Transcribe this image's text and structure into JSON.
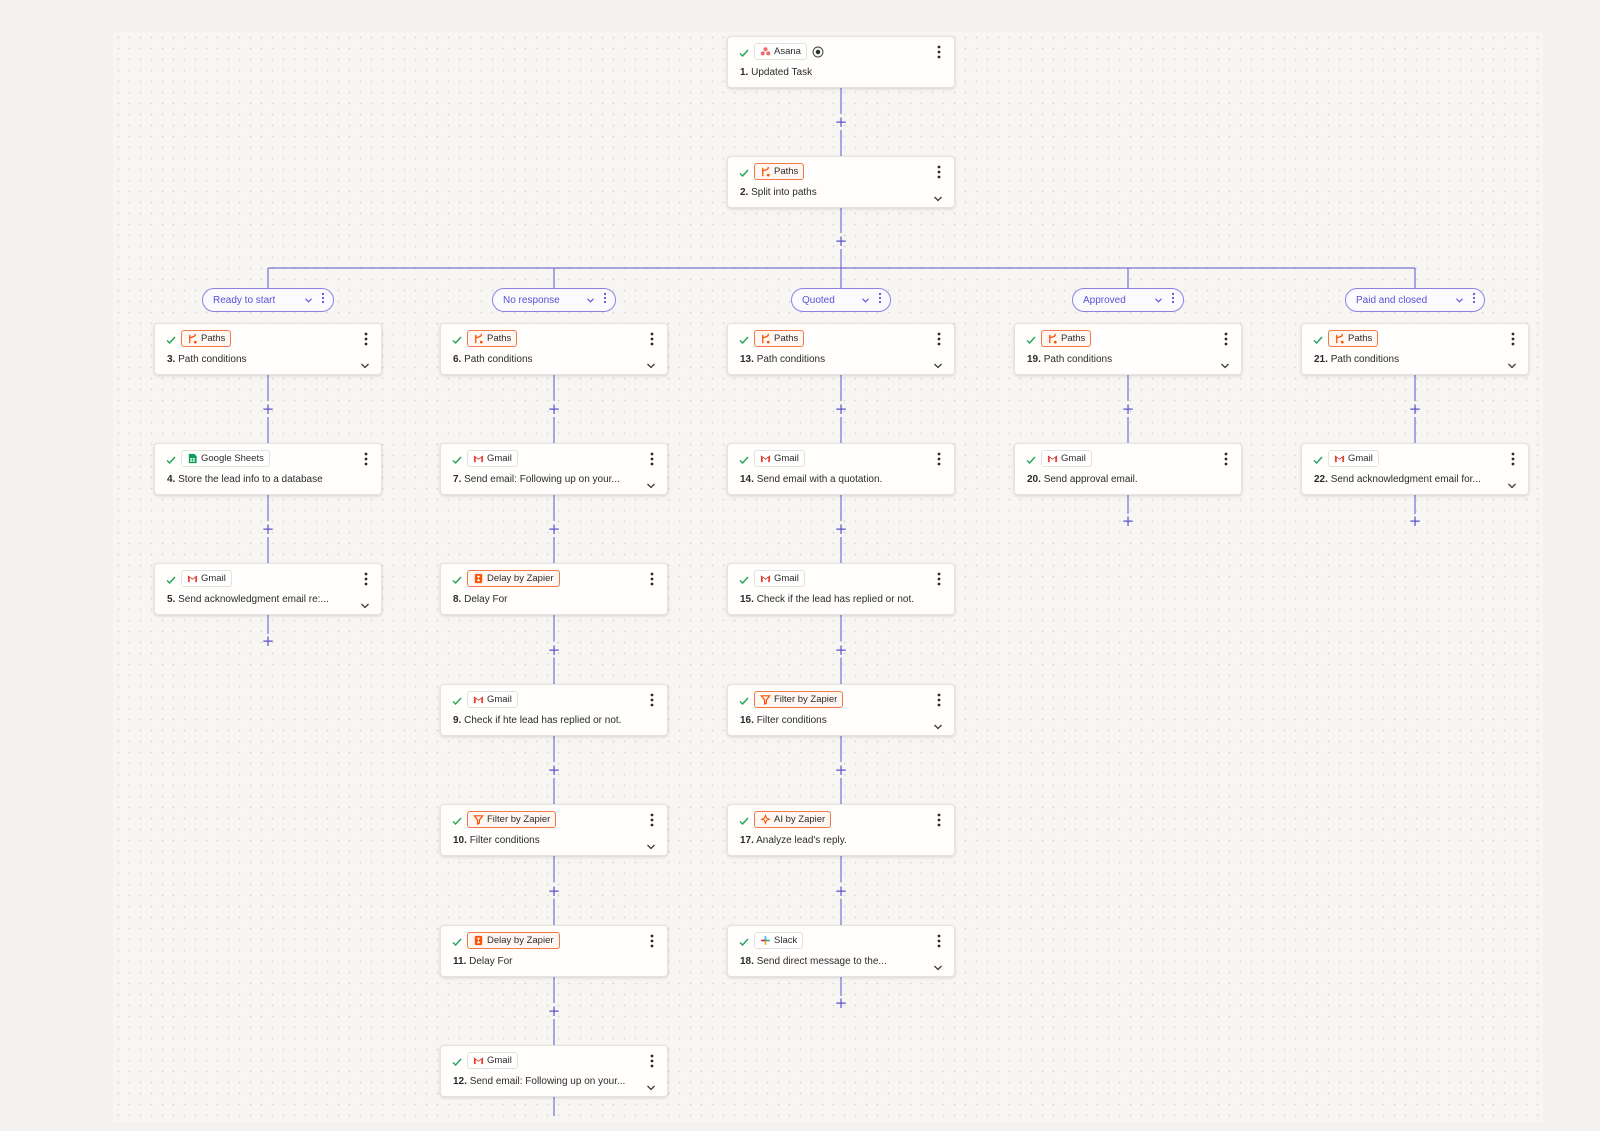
{
  "colors": {
    "accent": "#5b54cc",
    "check": "#23a35a",
    "zapier_orange": "#ff4f00"
  },
  "steps": [
    {
      "num": "1.",
      "app": "Asana",
      "icon": "asana-icon",
      "text": "Updated Task",
      "chevron": false
    },
    {
      "num": "2.",
      "app": "Paths",
      "icon": "paths-icon",
      "text": "Split into paths",
      "chevron": true
    },
    {
      "num": "3.",
      "app": "Paths",
      "icon": "paths-icon",
      "text": "Path conditions",
      "chevron": true
    },
    {
      "num": "4.",
      "app": "Google Sheets",
      "icon": "google-sheets-icon",
      "text": "Store the lead info to a database",
      "chevron": false
    },
    {
      "num": "5.",
      "app": "Gmail",
      "icon": "gmail-icon",
      "text": "Send acknowledgment email re:...",
      "chevron": true
    },
    {
      "num": "6.",
      "app": "Paths",
      "icon": "paths-icon",
      "text": "Path conditions",
      "chevron": true
    },
    {
      "num": "7.",
      "app": "Gmail",
      "icon": "gmail-icon",
      "text": "Send email: Following up on your...",
      "chevron": true
    },
    {
      "num": "8.",
      "app": "Delay by Zapier",
      "icon": "delay-icon",
      "text": "Delay For",
      "chevron": false
    },
    {
      "num": "9.",
      "app": "Gmail",
      "icon": "gmail-icon",
      "text": "Check if hte lead has replied or not.",
      "chevron": false
    },
    {
      "num": "10.",
      "app": "Filter by Zapier",
      "icon": "filter-icon",
      "text": "Filter conditions",
      "chevron": true
    },
    {
      "num": "11.",
      "app": "Delay by Zapier",
      "icon": "delay-icon",
      "text": "Delay For",
      "chevron": false
    },
    {
      "num": "12.",
      "app": "Gmail",
      "icon": "gmail-icon",
      "text": "Send email: Following up on your...",
      "chevron": true
    },
    {
      "num": "13.",
      "app": "Paths",
      "icon": "paths-icon",
      "text": "Path conditions",
      "chevron": true
    },
    {
      "num": "14.",
      "app": "Gmail",
      "icon": "gmail-icon",
      "text": "Send email with a quotation.",
      "chevron": false
    },
    {
      "num": "15.",
      "app": "Gmail",
      "icon": "gmail-icon",
      "text": "Check if the lead has replied or not.",
      "chevron": false
    },
    {
      "num": "16.",
      "app": "Filter by Zapier",
      "icon": "filter-icon",
      "text": "Filter conditions",
      "chevron": true
    },
    {
      "num": "17.",
      "app": "AI by Zapier",
      "icon": "ai-icon",
      "text": "Analyze lead's reply.",
      "chevron": false
    },
    {
      "num": "18.",
      "app": "Slack",
      "icon": "slack-icon",
      "text": "Send direct message to the...",
      "chevron": true
    },
    {
      "num": "19.",
      "app": "Paths",
      "icon": "paths-icon",
      "text": "Path conditions",
      "chevron": true
    },
    {
      "num": "20.",
      "app": "Gmail",
      "icon": "gmail-icon",
      "text": "Send approval email.",
      "chevron": false
    },
    {
      "num": "21.",
      "app": "Paths",
      "icon": "paths-icon",
      "text": "Path conditions",
      "chevron": true
    },
    {
      "num": "22.",
      "app": "Gmail",
      "icon": "gmail-icon",
      "text": "Send acknowledgment email for...",
      "chevron": true
    }
  ],
  "paths": [
    {
      "label": "Ready to start"
    },
    {
      "label": "No response"
    },
    {
      "label": "Quoted"
    },
    {
      "label": "Approved"
    },
    {
      "label": "Paid and closed"
    }
  ]
}
